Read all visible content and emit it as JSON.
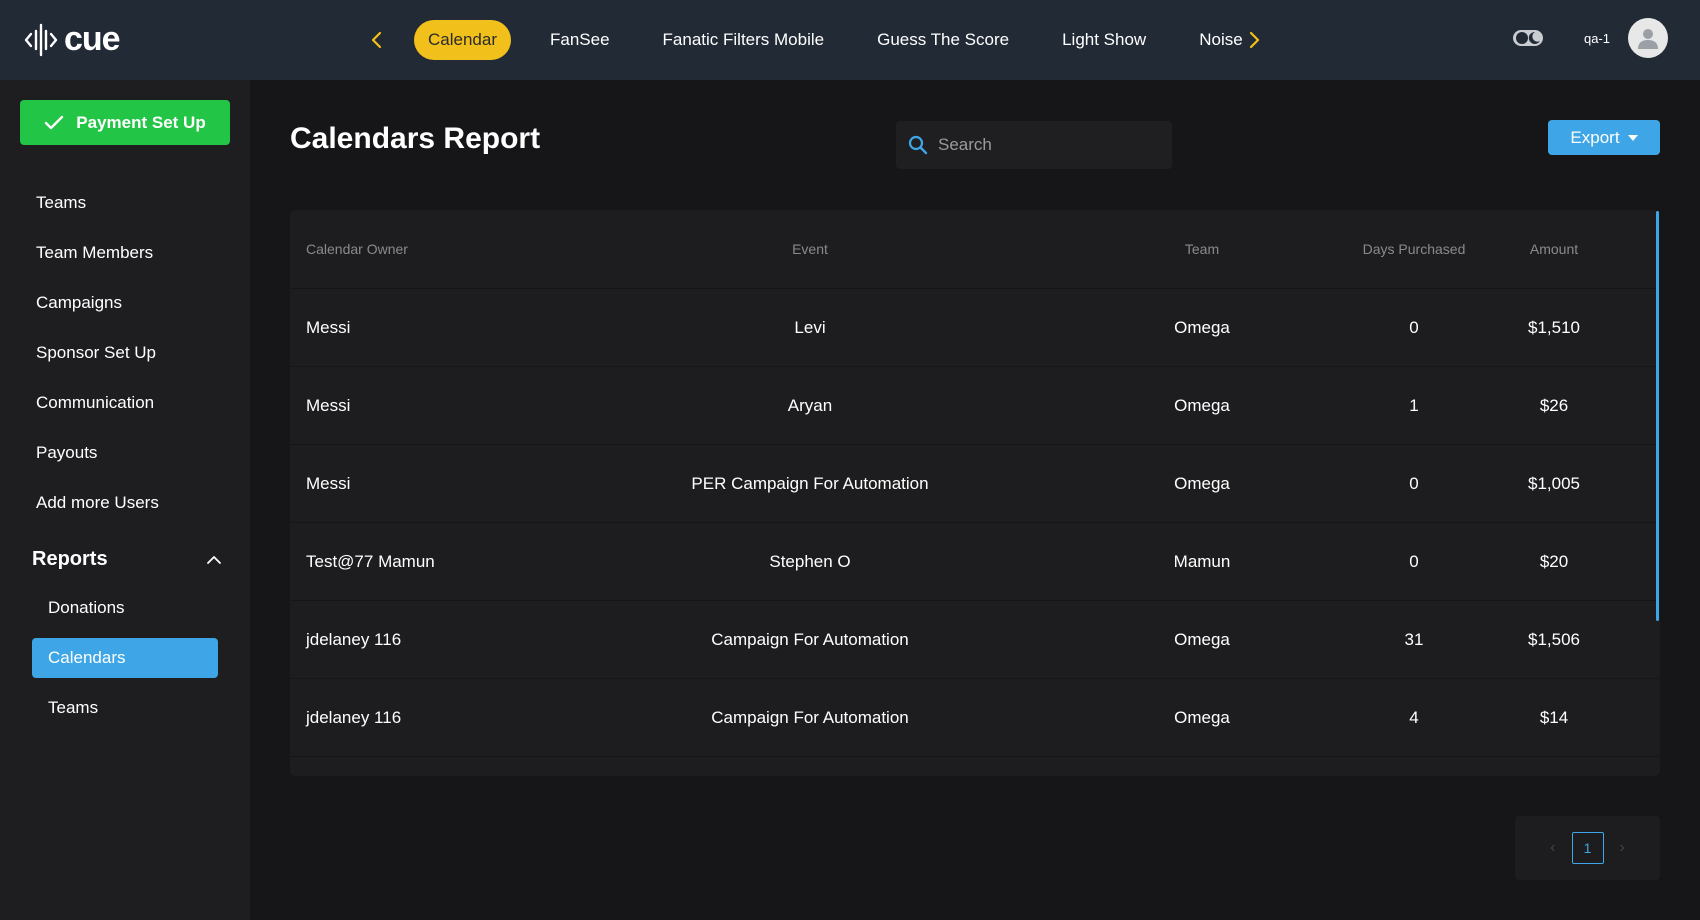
{
  "app": {
    "logo_text": "cue"
  },
  "topnav": {
    "tabs": [
      {
        "label": "Calendar",
        "active": true
      },
      {
        "label": "FanSee"
      },
      {
        "label": "Fanatic Filters Mobile"
      },
      {
        "label": "Guess The Score"
      },
      {
        "label": "Light Show"
      },
      {
        "label": "Noise"
      }
    ],
    "user_name": "qa-1"
  },
  "sidebar": {
    "payment_button": "Payment Set Up",
    "items": [
      "Teams",
      "Team Members",
      "Campaigns",
      "Sponsor Set Up",
      "Communication",
      "Payouts",
      "Add more Users"
    ],
    "reports": {
      "label": "Reports",
      "items": [
        {
          "label": "Donations"
        },
        {
          "label": "Calendars",
          "active": true
        },
        {
          "label": "Teams"
        }
      ]
    }
  },
  "main": {
    "title": "Calendars Report",
    "search_placeholder": "Search",
    "export_label": "Export",
    "table": {
      "columns": [
        "Calendar Owner",
        "Event",
        "Team",
        "Days Purchased",
        "Amount"
      ],
      "rows": [
        [
          "Messi",
          "Levi",
          "Omega",
          "0",
          "$1,510"
        ],
        [
          "Messi",
          "Aryan",
          "Omega",
          "1",
          "$26"
        ],
        [
          "Messi",
          "PER Campaign For Automation",
          "Omega",
          "0",
          "$1,005"
        ],
        [
          "Test@77 Mamun",
          "Stephen O",
          "Mamun",
          "0",
          "$20"
        ],
        [
          "jdelaney 116",
          "Campaign For Automation",
          "Omega",
          "31",
          "$1,506"
        ],
        [
          "jdelaney 116",
          "Campaign For Automation",
          "Omega",
          "4",
          "$14"
        ]
      ]
    },
    "pagination": {
      "current_page": "1"
    }
  },
  "colors": {
    "accent_yellow": "#f2c01a",
    "accent_blue": "#3ea6e6",
    "success_green": "#22c546",
    "topbar_bg": "#222a36",
    "page_bg": "#161618"
  },
  "icons": [
    "logo-waveform-icon",
    "chevron-left-icon",
    "chevron-right-icon",
    "theme-toggle-icon",
    "user-avatar-icon",
    "check-icon",
    "chevron-up-icon",
    "search-icon",
    "caret-down-icon"
  ]
}
